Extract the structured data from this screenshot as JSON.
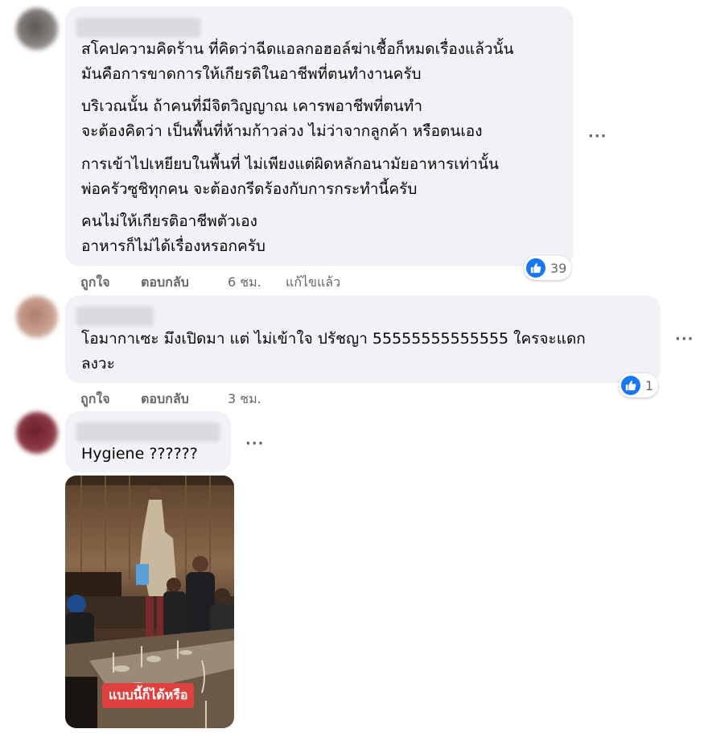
{
  "comments": [
    {
      "paragraphs": [
        "สโคปความคิดร้าน ที่คิดว่าฉีดแอลกอฮอล์ฆ่าเชื้อก็หมดเรื่องแล้วนั้น\nมันคือการขาดการให้เกียรติในอาชีพที่ตนทำงานครับ",
        "บริเวณนั้น ถ้าคนที่มีจิตวิญญาณ เคารพอาชีพที่ตนทำ\nจะต้องคิดว่า เป็นพื้นที่ห้ามก้าวล่วง ไม่ว่าจากลูกค้า หรือตนเอง",
        "การเข้าไปเหยียบในพื้นที่ ไม่เพียงแต่ผิดหลักอนามัยอาหารเท่านั้น\nพ่อครัวซูชิทุกคน จะต้องกรีดร้องกับการกระทำนี้ครับ",
        "คนไม่ให้เกียรติอาชีพตัวเอง\nอาหารก็ไม่ได้เรื่องหรอกครับ"
      ],
      "like_label": "ถูกใจ",
      "reply_label": "ตอบกลับ",
      "time": "6 ชม.",
      "edited": "แก้ไขแล้ว",
      "reaction_count": "39"
    },
    {
      "text": "โอมากาเซะ มึงเปิดมา แต่ ไม่เข้าใจ ปรัชญา 55555555555555 ใครจะแดก\nลงวะ",
      "like_label": "ถูกใจ",
      "reply_label": "ตอบกลับ",
      "time": "3 ชม.",
      "reaction_count": "1"
    },
    {
      "text": "Hygiene ??????",
      "photo_caption": "แบบนี้ก็ได้หรือ"
    }
  ],
  "more_label": "···",
  "colors": {
    "bubble": "#f0f2f5",
    "like_blue": "#1877f2",
    "meta_text": "#65676b",
    "caption_red": "#e0413f"
  },
  "icons": [
    "like-icon",
    "more-options-icon"
  ]
}
